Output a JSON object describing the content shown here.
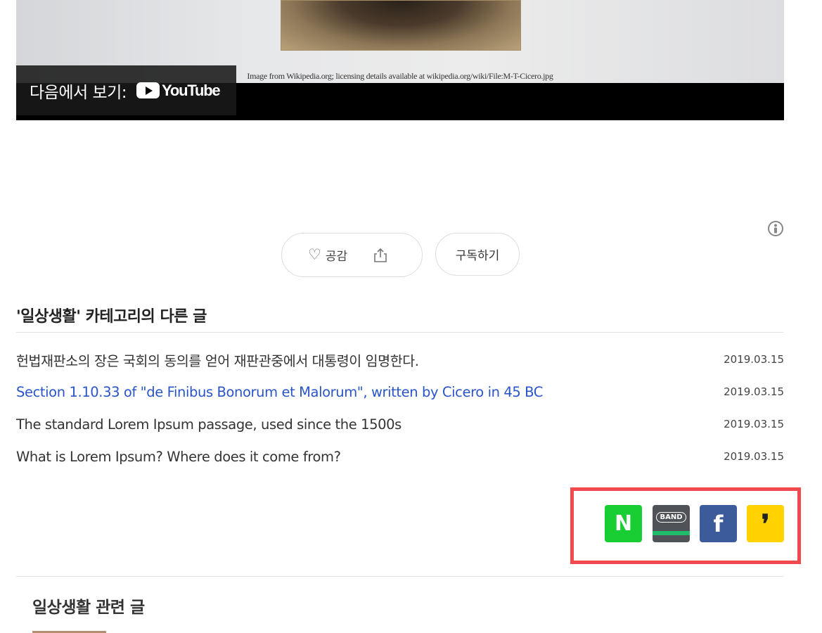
{
  "video": {
    "caption": "Image from Wikipedia.org; licensing details available at wikipedia.org/wiki/File:M-T-Cicero.jpg",
    "watch_on_label": "다음에서 보기:",
    "youtube_wordmark": "YouTube"
  },
  "reactions": {
    "like_label": "공감",
    "subscribe_label": "구독하기",
    "like_icon": "heart-icon",
    "share_icon": "share-icon"
  },
  "category": {
    "title": "'일상생활' 카테고리의 다른 글",
    "posts": [
      {
        "title": "헌법재판소의 장은 국회의 동의를 얻어 재판관중에서 대통령이 임명한다.",
        "date": "2019.03.15"
      },
      {
        "title": "Section 1.10.33 of \"de Finibus Bonorum et Malorum\", written by Cicero in 45 BC",
        "date": "2019.03.15"
      },
      {
        "title": "The standard Lorem Ipsum passage, used since the 1500s",
        "date": "2019.03.15"
      },
      {
        "title": "What is Lorem Ipsum? Where does it come from?",
        "date": "2019.03.15"
      }
    ]
  },
  "share": {
    "naver_label": "N",
    "band_label": "BAND",
    "facebook_label": "f",
    "kakao_label": "❜",
    "colors": {
      "naver": "#19ce32",
      "band": "#4f5257",
      "facebook": "#3b5b9b",
      "kakao": "#ffd200",
      "highlight_border": "#f04a4f"
    }
  },
  "related": {
    "title": "일상생활 관련 글"
  },
  "colors": {
    "link": "#2a55c8"
  }
}
